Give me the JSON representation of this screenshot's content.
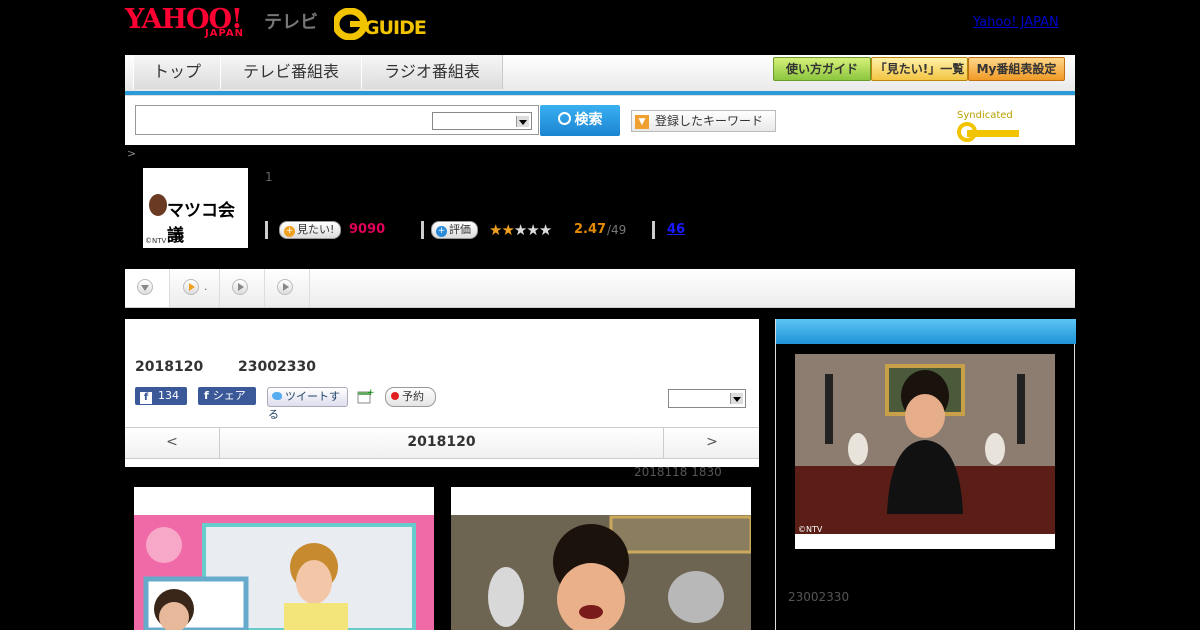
{
  "header": {
    "yahoo_logo": "YAHOO!",
    "yahoo_logo_sub": "JAPAN",
    "tv_label": "テレビ",
    "gguide_logo": "GUIDE",
    "yahoo_japan_link": "Yahoo! JAPAN"
  },
  "nav": {
    "tabs": [
      "トップ",
      "テレビ番組表",
      "ラジオ番組表"
    ],
    "right_buttons": [
      "使い方ガイド",
      "「見たい!」一覧",
      "My番組表設定"
    ]
  },
  "search": {
    "input_value": "",
    "select_value": "",
    "button_label": "検索",
    "keyword_button": "登録したキーワード",
    "syndicated_label": "Syndicated"
  },
  "program": {
    "breadcrumb": ">",
    "thumb_title": "マツコ会議",
    "thumb_credit": "©NTV",
    "episode_number": "1",
    "mitai_label": "見たい!",
    "mitai_count": "9090",
    "rating_label": "評価",
    "rating_value": "2.47",
    "rating_max": 5,
    "rating_total": "/49",
    "review_count": "46"
  },
  "tabs_row": {
    "items": [
      "",
      ".",
      "",
      ""
    ]
  },
  "main": {
    "air_date": "2018120",
    "air_time": "23002330",
    "fb_count": "134",
    "fb_share": "シェア",
    "tweet": "ツイートする",
    "reserve": "予約",
    "select_value": "",
    "prev_arrow": "<",
    "center_date": "2018120",
    "next_arrow": ">"
  },
  "episodes": {
    "prev_air": "2018118  1830"
  },
  "sidebar": {
    "image_credit": "©NTV",
    "time": "23002330"
  },
  "colors": {
    "yahoo_red": "#ff0033",
    "accent_blue": "#2b9ad8",
    "mitai_pink": "#e0005a",
    "rating_orange": "#e38b00"
  }
}
